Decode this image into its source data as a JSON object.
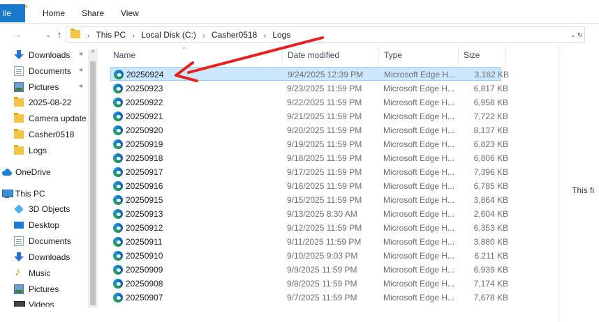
{
  "ribbon": {
    "tabs": [
      {
        "label": "ile"
      },
      {
        "label": "Home"
      },
      {
        "label": "Share"
      },
      {
        "label": "View"
      }
    ]
  },
  "address": {
    "crumbs": [
      "This PC",
      "Local Disk (C:)",
      "Casher0518",
      "Logs"
    ],
    "refresh_glyph": "⌄ ↻"
  },
  "navpane": {
    "items": [
      {
        "label": "Downloads",
        "icon": "download-icon",
        "pinned": true
      },
      {
        "label": "Documents",
        "icon": "document-icon",
        "pinned": true
      },
      {
        "label": "Pictures",
        "icon": "pictures-icon",
        "pinned": true
      },
      {
        "label": "2025-08-22",
        "icon": "folder-icon",
        "pinned": false
      },
      {
        "label": "Camera update f",
        "icon": "folder-icon",
        "pinned": false
      },
      {
        "label": "Casher0518",
        "icon": "folder-icon",
        "pinned": false
      },
      {
        "label": "Logs",
        "icon": "folder-icon",
        "pinned": false
      },
      {
        "label": "OneDrive",
        "icon": "onedrive-icon",
        "pinned": false
      },
      {
        "label": "This PC",
        "icon": "computer-icon",
        "pinned": false
      },
      {
        "label": "3D Objects",
        "icon": "3d-objects-icon",
        "pinned": false
      },
      {
        "label": "Desktop",
        "icon": "desktop-icon",
        "pinned": false
      },
      {
        "label": "Documents",
        "icon": "document-icon",
        "pinned": false
      },
      {
        "label": "Downloads",
        "icon": "download-icon",
        "pinned": false
      },
      {
        "label": "Music",
        "icon": "music-icon",
        "pinned": false
      },
      {
        "label": "Pictures",
        "icon": "pictures-icon",
        "pinned": false
      },
      {
        "label": "Videos",
        "icon": "videos-icon",
        "pinned": false
      }
    ]
  },
  "filelist": {
    "columns": {
      "name": "Name",
      "date": "Date modified",
      "type": "Type",
      "size": "Size"
    },
    "rows": [
      {
        "name": "20250924",
        "date": "9/24/2025 12:39 PM",
        "type": "Microsoft Edge H...",
        "size": "3,162 KB",
        "selected": true
      },
      {
        "name": "20250923",
        "date": "9/23/2025 11:59 PM",
        "type": "Microsoft Edge H...",
        "size": "6,817 KB"
      },
      {
        "name": "20250922",
        "date": "9/22/2025 11:59 PM",
        "type": "Microsoft Edge H...",
        "size": "6,958 KB"
      },
      {
        "name": "20250921",
        "date": "9/21/2025 11:59 PM",
        "type": "Microsoft Edge H...",
        "size": "7,722 KB"
      },
      {
        "name": "20250920",
        "date": "9/20/2025 11:59 PM",
        "type": "Microsoft Edge H...",
        "size": "8,137 KB"
      },
      {
        "name": "20250919",
        "date": "9/19/2025 11:59 PM",
        "type": "Microsoft Edge H...",
        "size": "6,823 KB"
      },
      {
        "name": "20250918",
        "date": "9/18/2025 11:59 PM",
        "type": "Microsoft Edge H...",
        "size": "6,806 KB"
      },
      {
        "name": "20250917",
        "date": "9/17/2025 11:59 PM",
        "type": "Microsoft Edge H...",
        "size": "7,396 KB"
      },
      {
        "name": "20250916",
        "date": "9/16/2025 11:59 PM",
        "type": "Microsoft Edge H...",
        "size": "6,785 KB"
      },
      {
        "name": "20250915",
        "date": "9/15/2025 11:59 PM",
        "type": "Microsoft Edge H...",
        "size": "3,864 KB"
      },
      {
        "name": "20250913",
        "date": "9/13/2025 8:30 AM",
        "type": "Microsoft Edge H...",
        "size": "2,604 KB"
      },
      {
        "name": "20250912",
        "date": "9/12/2025 11:59 PM",
        "type": "Microsoft Edge H...",
        "size": "6,353 KB"
      },
      {
        "name": "20250911",
        "date": "9/11/2025 11:59 PM",
        "type": "Microsoft Edge H...",
        "size": "3,880 KB"
      },
      {
        "name": "20250910",
        "date": "9/10/2025 9:03 PM",
        "type": "Microsoft Edge H...",
        "size": "6,211 KB"
      },
      {
        "name": "20250909",
        "date": "9/9/2025 11:59 PM",
        "type": "Microsoft Edge H...",
        "size": "6,939 KB"
      },
      {
        "name": "20250908",
        "date": "9/8/2025 11:59 PM",
        "type": "Microsoft Edge H...",
        "size": "7,174 KB"
      },
      {
        "name": "20250907",
        "date": "9/7/2025 11:59 PM",
        "type": "Microsoft Edge H...",
        "size": "7,678 KB"
      }
    ]
  },
  "preview": {
    "message": "This fi"
  },
  "annotation": {
    "color": "#e8201f"
  },
  "colors": {
    "file_tab": "#1979ca",
    "selection": "#cce8ff",
    "selection_border": "#99d1ff"
  }
}
